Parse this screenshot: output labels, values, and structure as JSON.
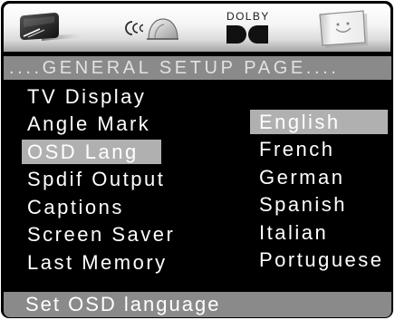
{
  "page": {
    "title": "....GENERAL SETUP PAGE...."
  },
  "tabs": [
    {
      "icon": "general-setup-icon"
    },
    {
      "icon": "audio-setup-icon"
    },
    {
      "icon": "dolby-icon",
      "label": "DOLBY"
    },
    {
      "icon": "preferences-icon"
    }
  ],
  "menu": {
    "selected_index": 2,
    "items": [
      {
        "label": "TV Display"
      },
      {
        "label": "Angle Mark"
      },
      {
        "label": "OSD Lang"
      },
      {
        "label": "Spdif Output"
      },
      {
        "label": "Captions"
      },
      {
        "label": "Screen Saver"
      },
      {
        "label": "Last Memory"
      }
    ]
  },
  "options": {
    "selected_index": 0,
    "items": [
      {
        "label": "English"
      },
      {
        "label": "French"
      },
      {
        "label": "German"
      },
      {
        "label": "Spanish"
      },
      {
        "label": "Italian"
      },
      {
        "label": "Portuguese"
      }
    ]
  },
  "status": {
    "text": "Set OSD language"
  },
  "colors": {
    "background": "#000000",
    "bar": "#8a8a8a",
    "highlight": "#b0b0b0",
    "text": "#ffffff",
    "title_text": "#e2e2e2"
  }
}
